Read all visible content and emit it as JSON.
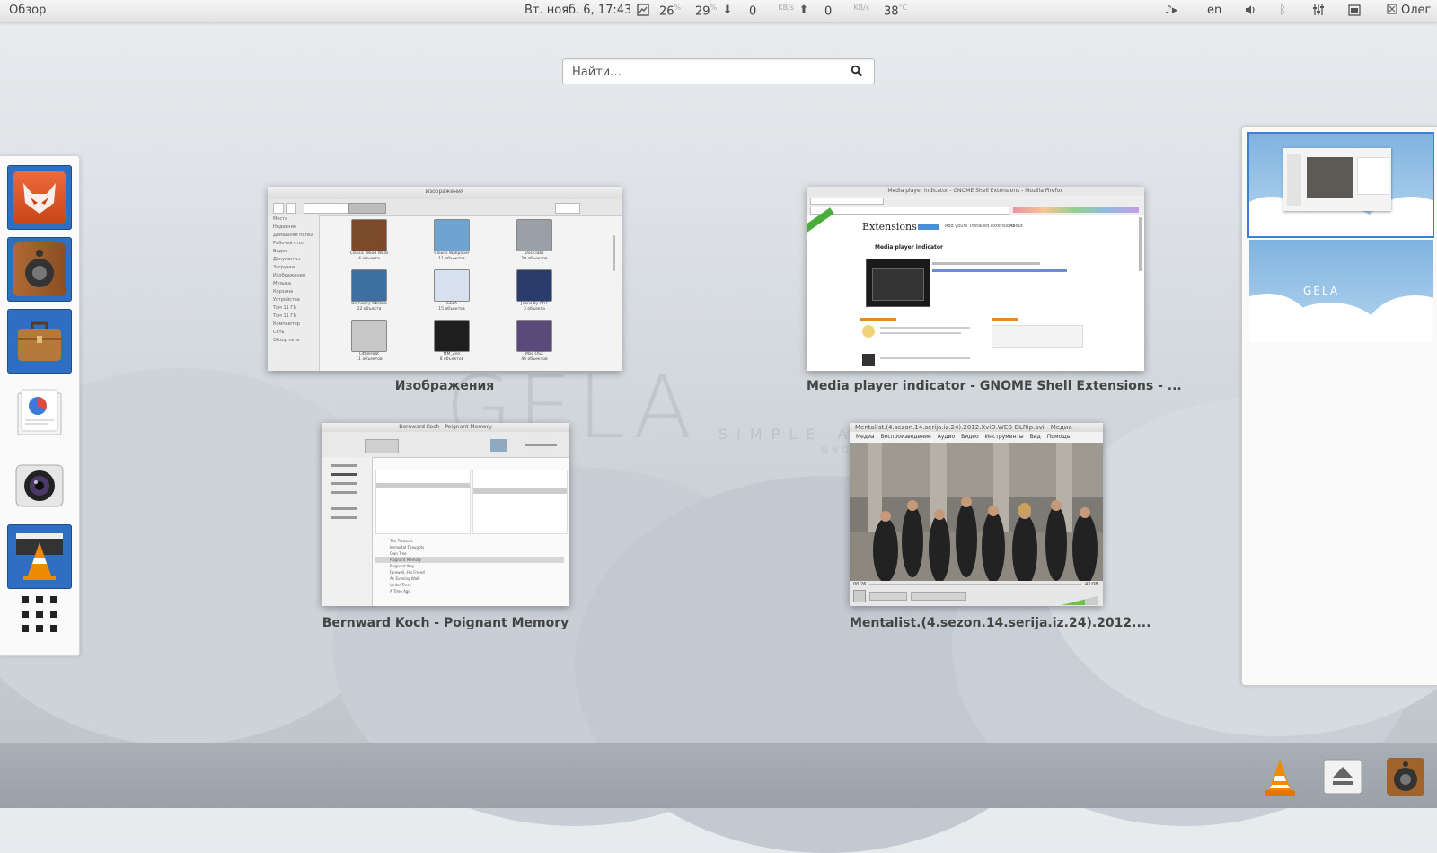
{
  "topbar": {
    "activities": "Обзор",
    "clock": "Вт. нояб.  6, 17:43",
    "cpu": "26",
    "cpu_unit": "%",
    "mem": "29",
    "mem_unit": "%",
    "net_down": "0",
    "net_down_unit": "KB/s",
    "net_up": "0",
    "net_up_unit": "KB/s",
    "temp": "38",
    "temp_unit": "°C",
    "keyboard": "en",
    "user": "Олег"
  },
  "search": {
    "placeholder": "Найти..."
  },
  "dash": {
    "items": [
      {
        "name": "foxy-app",
        "color": "#d9552a"
      },
      {
        "name": "speaker-app",
        "color": "#9c5a2c"
      },
      {
        "name": "briefcase-app",
        "color": "#a86a34"
      },
      {
        "name": "presentation-app",
        "color": "#e8e8e8"
      },
      {
        "name": "camera-app",
        "color": "#333333"
      },
      {
        "name": "vlc-app",
        "color": "#f08a00"
      }
    ]
  },
  "wallpaper": {
    "title": "GELA",
    "subtitle": "SIMPLE A",
    "subtitle2": "GNO"
  },
  "windows": [
    {
      "caption": "Изображения",
      "title": "Изображения",
      "sidebar": [
        "Места",
        "Недавние",
        "Домашняя папка",
        "Рабочий стол",
        "Видео",
        "Документы",
        "Загрузки",
        "Изображения",
        "Музыка",
        "Корзина",
        "Устройства",
        "Том 11 ГБ",
        "Том 11 ГБ",
        "Компьютер",
        "Сеть",
        "Обзор сети"
      ],
      "folders": [
        {
          "name": "Classic Wood Walls",
          "count": "4 объекта"
        },
        {
          "name": "Clouds Wallpaper",
          "count": "11 объектов"
        },
        {
          "name": "DockTabs",
          "count": "20 объектов"
        },
        {
          "name": "Bernwary Obrana",
          "count": "22 объекта"
        },
        {
          "name": "GELA",
          "count": "15 объектов"
        },
        {
          "name": "Jeans By AR7",
          "count": "2 объекта"
        },
        {
          "name": "LittleHeat",
          "count": "11 объектов"
        },
        {
          "name": "MM_Zen",
          "count": "8 объектов"
        },
        {
          "name": "Mac OSX",
          "count": "46 объектов"
        }
      ]
    },
    {
      "caption": "Media player indicator - GNOME Shell Extensions - ...",
      "title": "Media player indicator - GNOME Shell Extensions - Mozilla Firefox",
      "site": "Extensions",
      "heading": "Media player indicator",
      "nav": [
        "Extensions",
        "Add yours",
        "Installed extensions",
        "About"
      ]
    },
    {
      "caption": "Bernward Koch - Poignant Memory",
      "title": "Bernward Koch - Poignant Memory",
      "tracks": [
        "The Treasure",
        "Immortal Thoughts",
        "Own Tree",
        "Poignant Memory",
        "Poignant Way",
        "Farewell, His Friend",
        "An Evening Walk",
        "Under Trees",
        "A Time Ago"
      ]
    },
    {
      "caption": "Mentalist.(4.sezon.14.serija.iz.24).2012....",
      "title": "Mentalist.(4.sezon.14.serija.iz.24).2012.XviD.WEB-DLRip.avi - Медиа-проигрыва...",
      "menu": [
        "Медиа",
        "Воспроизведение",
        "Аудио",
        "Видео",
        "Инструменты",
        "Вид",
        "Помощь"
      ],
      "time_elapsed": "00:26",
      "time_total": "43:08"
    }
  ],
  "workspaces": [
    {
      "label": ""
    },
    {
      "label": "GELA"
    }
  ],
  "tray": [
    {
      "name": "vlc"
    },
    {
      "name": "eject"
    },
    {
      "name": "speaker"
    }
  ]
}
